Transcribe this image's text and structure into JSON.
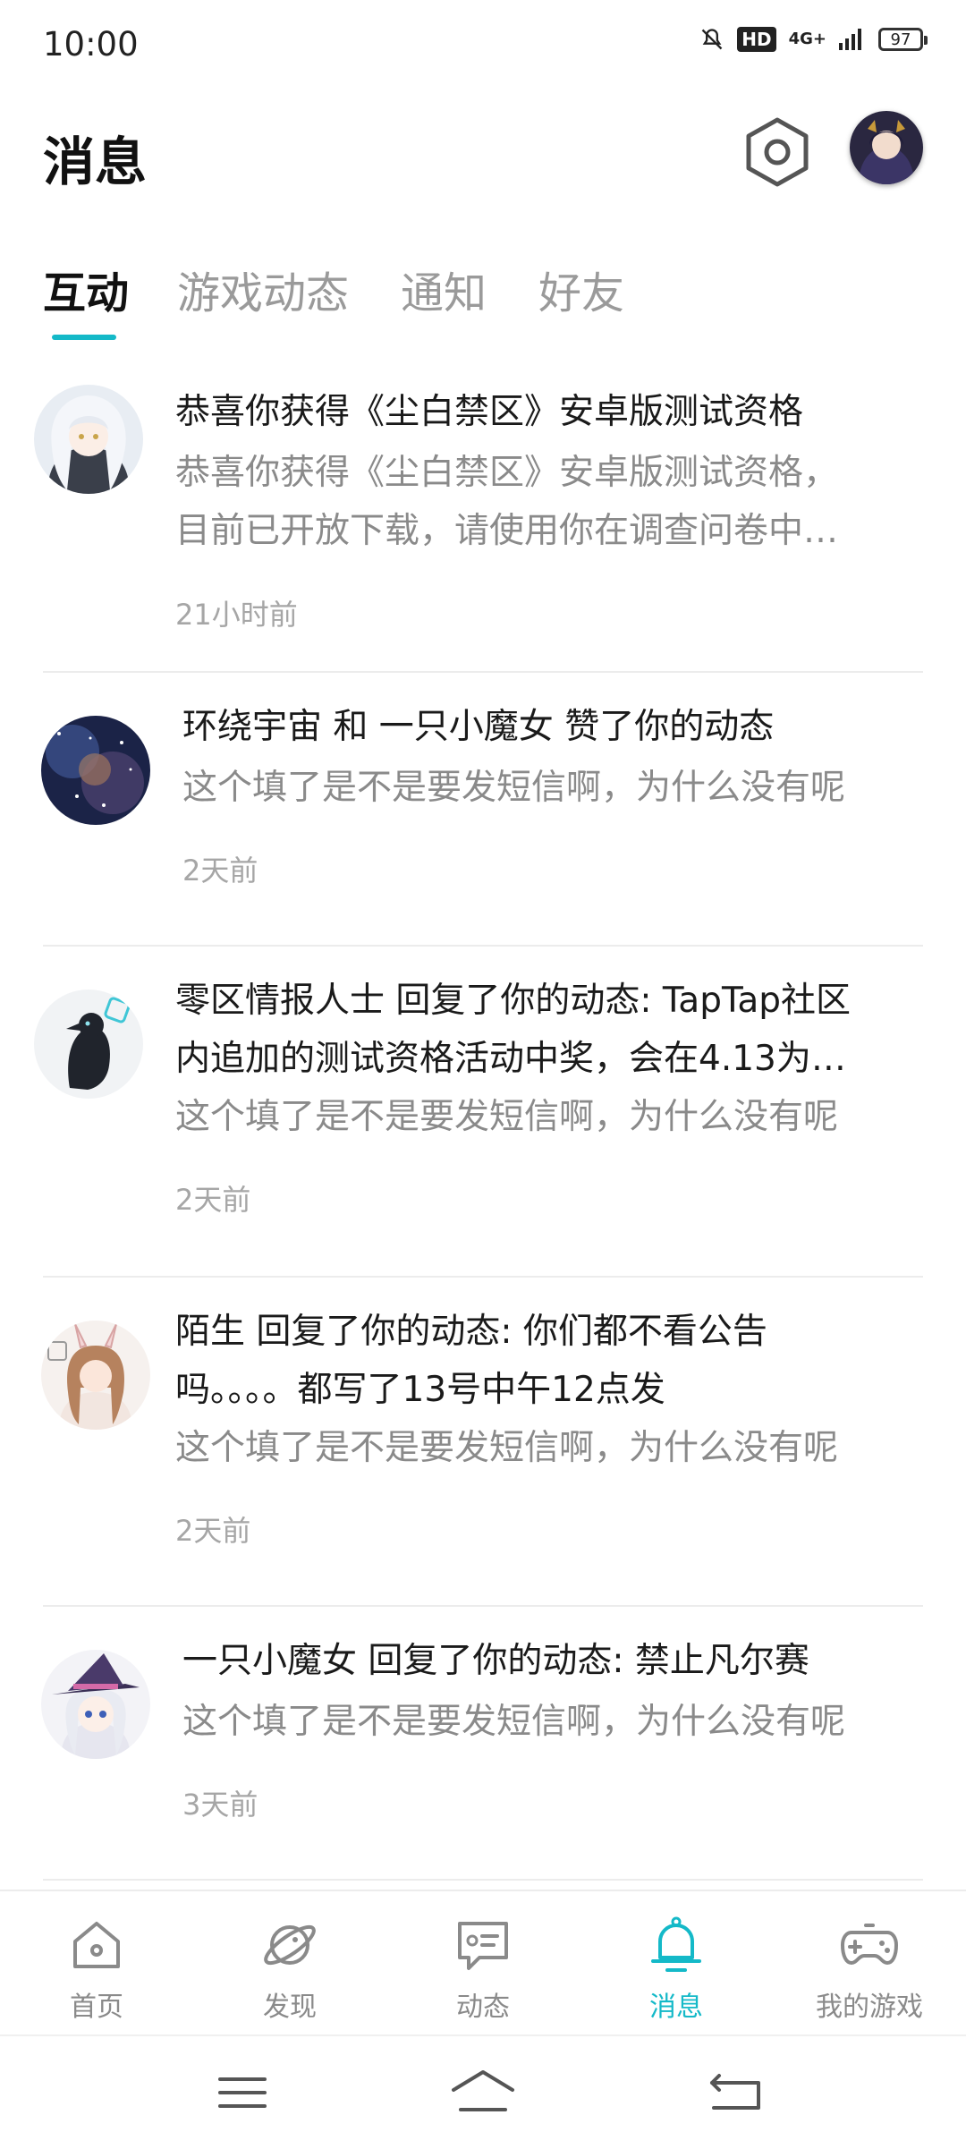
{
  "status_bar": {
    "time": "10:00",
    "network": "4G+",
    "hd": "HD",
    "battery": "97"
  },
  "header": {
    "title": "消息"
  },
  "tabs": [
    {
      "label": "互动",
      "active": true
    },
    {
      "label": "游戏动态",
      "active": false
    },
    {
      "label": "通知",
      "active": false
    },
    {
      "label": "好友",
      "active": false
    }
  ],
  "accent_color": "#14b9c8",
  "messages": [
    {
      "title": "恭喜你获得《尘白禁区》安卓版测试资格",
      "preview_1": "恭喜你获得《尘白禁区》安卓版测试资格，",
      "preview_2": "目前已开放下载，请使用你在调查问卷中…",
      "time": "21小时前",
      "avatar": "white-hair-girl-avatar"
    },
    {
      "title": "环绕宇宙 和 一只小魔女 赞了你的动态",
      "preview": "这个填了是不是要发短信啊，为什么没有呢",
      "time": "2天前",
      "avatar": "galaxy-avatar"
    },
    {
      "title_1": "零区情报人士 回复了你的动态: TapTap社区",
      "title_2": "内追加的测试资格活动中奖，会在4.13为…",
      "preview": "这个填了是不是要发短信啊，为什么没有呢",
      "time": "2天前",
      "avatar": "crow-avatar"
    },
    {
      "title_1": "陌生 回复了你的动态: 你们都不看公告",
      "title_2": "吗。。。。都写了13号中午12点发",
      "preview": "这个填了是不是要发短信啊，为什么没有呢",
      "time": "2天前",
      "avatar": "bunny-girl-avatar"
    },
    {
      "title": "一只小魔女 回复了你的动态: 禁止凡尔赛",
      "preview": "这个填了是不是要发短信啊，为什么没有呢",
      "time": "3天前",
      "avatar": "witch-avatar"
    }
  ],
  "bottom_nav": [
    {
      "label": "首页",
      "icon": "home-icon",
      "active": false
    },
    {
      "label": "发现",
      "icon": "planet-icon",
      "active": false
    },
    {
      "label": "动态",
      "icon": "chat-icon",
      "active": false
    },
    {
      "label": "消息",
      "icon": "bell-icon",
      "active": true
    },
    {
      "label": "我的游戏",
      "icon": "gamepad-icon",
      "active": false
    }
  ]
}
